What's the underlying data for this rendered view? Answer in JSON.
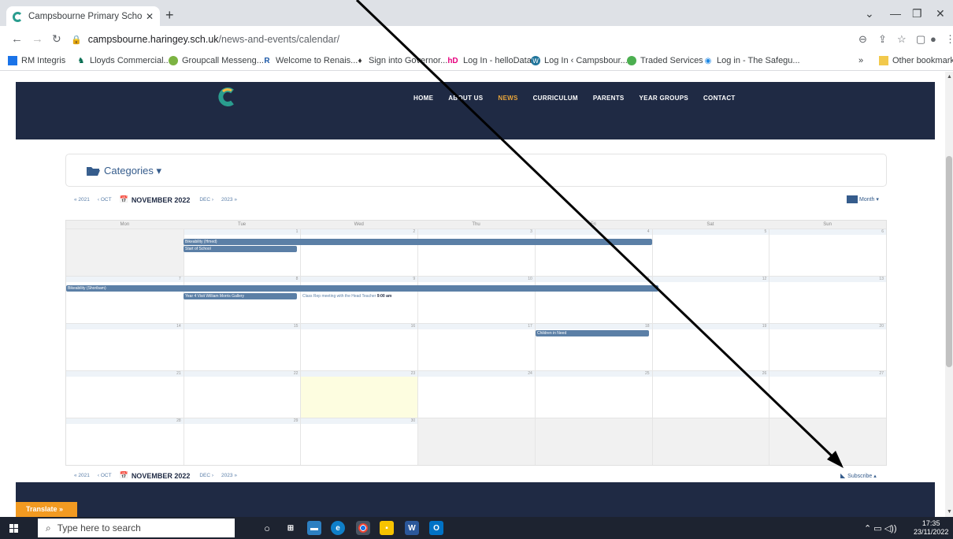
{
  "browser": {
    "tab_title": "Campsbourne Primary School | C",
    "url_host": "campsbourne.haringey.sch.uk",
    "url_path": "/news-and-events/calendar/",
    "bookmarks": [
      {
        "label": "RM Integris",
        "icon": "rm-icon",
        "color": "#1a73e8"
      },
      {
        "label": "Lloyds Commercial...",
        "icon": "horse-icon",
        "color": "#006a4d"
      },
      {
        "label": "Groupcall Messeng...",
        "icon": "groupcall-icon",
        "color": "#7cb342"
      },
      {
        "label": "Welcome to Renais...",
        "icon": "renaissance-icon",
        "color": "#1e5aa8"
      },
      {
        "label": "Sign into Governor...",
        "icon": "governor-icon",
        "color": "#333333"
      },
      {
        "label": "Log In - helloData",
        "icon": "hellodata-icon",
        "color": "#e6007e"
      },
      {
        "label": "Log In ‹ Campsbour...",
        "icon": "wordpress-icon",
        "color": "#21759b"
      },
      {
        "label": "Traded Services",
        "icon": "traded-icon",
        "color": "#4caf50"
      },
      {
        "label": "Log in - The Safegu...",
        "icon": "safeguard-icon",
        "color": "#1e88e5"
      }
    ],
    "overflow_label": "»",
    "other_bookmarks": "Other bookmarks"
  },
  "site": {
    "nav": [
      {
        "label": "HOME",
        "active": false
      },
      {
        "label": "ABOUT US",
        "active": false
      },
      {
        "label": "NEWS",
        "active": true
      },
      {
        "label": "CURRICULUM",
        "active": false
      },
      {
        "label": "PARENTS",
        "active": false
      },
      {
        "label": "YEAR GROUPS",
        "active": false
      },
      {
        "label": "CONTACT",
        "active": false
      }
    ],
    "colors": {
      "header": "#1f2a44",
      "accent": "#e8a53a",
      "event": "#5b7fa6"
    }
  },
  "calendar": {
    "categories_label": "Categories ▾",
    "prev_year": "« 2021",
    "prev_month": "‹ OCT",
    "current": "NOVEMBER 2022",
    "next_month": "DEC ›",
    "next_year": "2023 »",
    "view_label": "Month ▾",
    "weekdays": [
      "Mon",
      "Tue",
      "Wed",
      "Thu",
      "Fri",
      "Sat",
      "Sun"
    ],
    "weeks": [
      [
        "",
        "1",
        "2",
        "3",
        "4",
        "5",
        "6"
      ],
      [
        "7",
        "8",
        "9",
        "10",
        "11",
        "12",
        "13"
      ],
      [
        "14",
        "15",
        "16",
        "17",
        "18",
        "19",
        "20"
      ],
      [
        "21",
        "22",
        "23",
        "24",
        "25",
        "26",
        "27"
      ],
      [
        "28",
        "29",
        "30",
        "",
        "",
        "",
        ""
      ]
    ],
    "today": "23",
    "events": {
      "bikeability_hornsey": "Bikeability (Hmed)",
      "start_of_school": "Start of School",
      "bikeability_shoreham": "Bikeability (Shoribam)",
      "year4_visit": "Year 4 Visit William Morris Gallery",
      "class_rep_meeting": "Class Rep meeting with the Head Teacher",
      "class_rep_time": "9:00 am",
      "children_in_need": "Children in Need"
    },
    "subscribe_label": "Subscribe ▴"
  },
  "translate_label": "Translate »",
  "taskbar": {
    "search_placeholder": "Type here to search",
    "time": "17:35",
    "date": "23/11/2022"
  }
}
